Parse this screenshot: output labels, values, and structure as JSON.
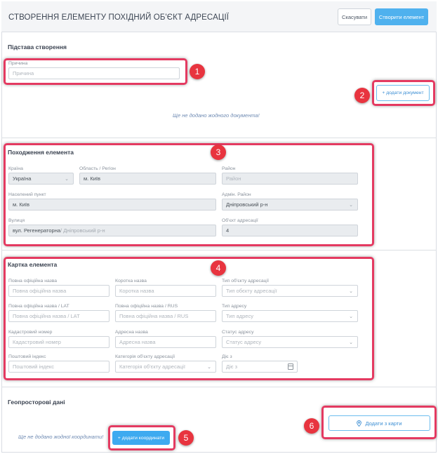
{
  "header": {
    "title": "СТВОРЕННЯ ЕЛЕМЕНТУ ПОХІДНИЙ ОБ'ЄКТ АДРЕСАЦІЇ",
    "cancel_label": "Скасувати",
    "create_label": "Створити елемент"
  },
  "basis": {
    "title": "Підстава створення",
    "reason_label": "Причина",
    "reason_placeholder": "Причина",
    "add_doc_label": "+ додати документ",
    "empty_text": "Ще не додано жодного документа!"
  },
  "origin": {
    "title": "Походження елемента",
    "country_label": "Країна",
    "country_value": "Україна",
    "region_label": "Область / Регіон",
    "region_value": "м. Київ",
    "district_label": "Район",
    "district_placeholder": "Район",
    "settlement_label": "Населений пункт",
    "settlement_value": "м. Київ",
    "admin_district_label": "Адмін. Район",
    "admin_district_value": "Дніпровський р-н",
    "street_label": "Вулиця",
    "street_value": "вул. Регенераторна",
    "street_suffix": " / Дніпровський р-н",
    "object_label": "Об'єкт адресації",
    "object_value": "4"
  },
  "card": {
    "title": "Картка елемента",
    "full_name_label": "Повна офіційна назва",
    "full_name_placeholder": "Повна офіційна назва",
    "short_name_label": "Коротка назва",
    "short_name_placeholder": "Коротка назва",
    "object_type_label": "Тип об'єкту адресації",
    "object_type_placeholder": "Тип обєкту адресації",
    "full_name_lat_label": "Повна офіційна назва / LAT",
    "full_name_lat_placeholder": "Повна офіційна назва / LAT",
    "full_name_rus_label": "Повна офіційна назва / RUS",
    "full_name_rus_placeholder": "Повна офіційна назва / RUS",
    "address_type_label": "Тип адресу",
    "address_type_placeholder": "Тип адресу",
    "cadastral_label": "Кадастровий номер",
    "cadastral_placeholder": "Кадастровий номер",
    "address_name_label": "Адресна назва",
    "address_name_placeholder": "Адресна назва",
    "address_status_label": "Статус адресу",
    "address_status_placeholder": "Статус адресу",
    "postal_label": "Поштовий індекс",
    "postal_placeholder": "Поштовий індекс",
    "category_label": "Категорія об'єкту адресації",
    "category_placeholder": "Категорія об'єкту адресації",
    "valid_from_label": "Діє з",
    "valid_from_placeholder": "Діє з"
  },
  "geo": {
    "title": "Геопросторові дані",
    "empty_text": "Ще не додано жодної координати!",
    "add_coord_label": "+ додати координати",
    "map_label": "Додати з карти"
  },
  "badges": [
    "1",
    "2",
    "3",
    "4",
    "5",
    "6"
  ]
}
